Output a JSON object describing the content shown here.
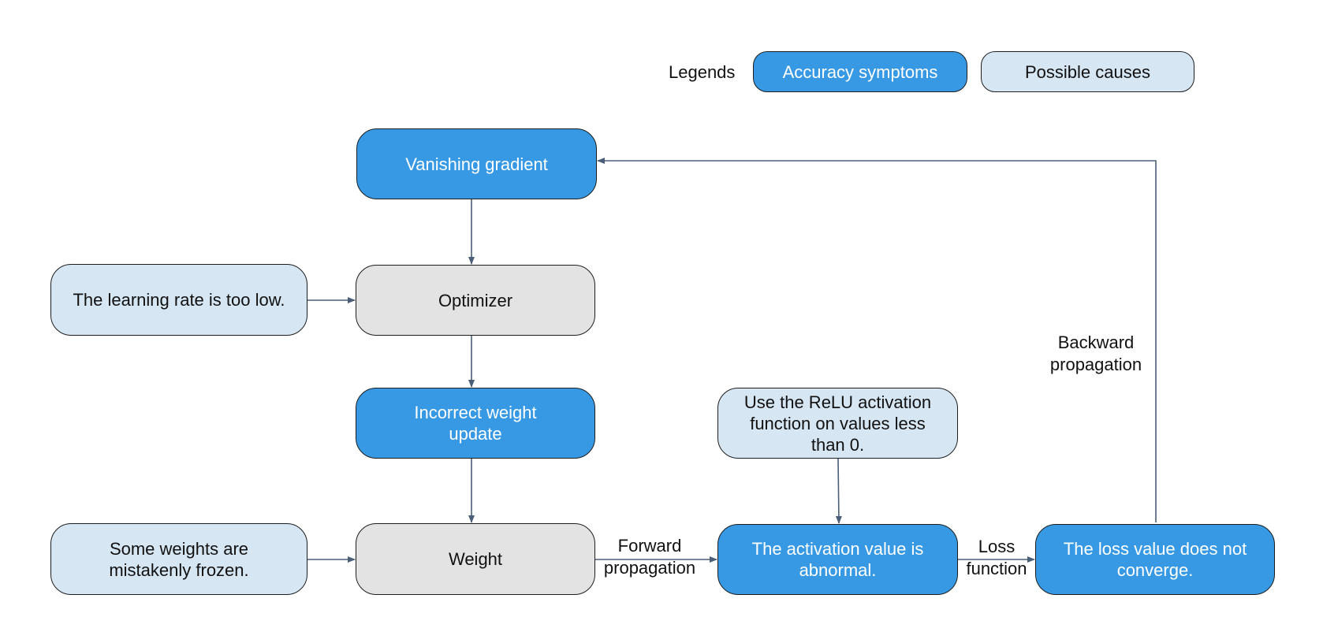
{
  "legend": {
    "title": "Legends",
    "items": [
      {
        "key": "symptom",
        "label": "Accuracy symptoms",
        "color": "#3799e3"
      },
      {
        "key": "cause",
        "label": "Possible causes",
        "color": "#d6e6f3"
      }
    ]
  },
  "colors": {
    "symptom": "#3799e3",
    "cause": "#d6e6f3",
    "process": "#e3e3e3",
    "connector": "#4a5e78",
    "border": "#1e1e1e"
  },
  "nodes": {
    "vanishing_gradient": {
      "label": "Vanishing gradient",
      "type": "symptom"
    },
    "learning_rate": {
      "label": "The learning rate is too low.",
      "type": "cause"
    },
    "optimizer": {
      "label": "Optimizer",
      "type": "process"
    },
    "incorrect_weight_update": {
      "label": "Incorrect weight\nupdate",
      "type": "symptom"
    },
    "frozen_weights": {
      "label": "Some weights are\nmistakenly frozen.",
      "type": "cause"
    },
    "weight": {
      "label": "Weight",
      "type": "process"
    },
    "relu": {
      "label": "Use the ReLU activation\nfunction on values less\nthan 0.",
      "type": "cause"
    },
    "activation_abnormal": {
      "label": "The activation value is\nabnormal.",
      "type": "symptom"
    },
    "loss_not_converge": {
      "label": "The loss value does not\nconverge.",
      "type": "symptom"
    }
  },
  "edges": [
    {
      "from": "vanishing_gradient",
      "to": "optimizer",
      "label": ""
    },
    {
      "from": "learning_rate",
      "to": "optimizer",
      "label": ""
    },
    {
      "from": "optimizer",
      "to": "incorrect_weight_update",
      "label": ""
    },
    {
      "from": "incorrect_weight_update",
      "to": "weight",
      "label": ""
    },
    {
      "from": "frozen_weights",
      "to": "weight",
      "label": ""
    },
    {
      "from": "weight",
      "to": "activation_abnormal",
      "label": "Forward\npropagation"
    },
    {
      "from": "relu",
      "to": "activation_abnormal",
      "label": ""
    },
    {
      "from": "activation_abnormal",
      "to": "loss_not_converge",
      "label": "Loss\nfunction"
    },
    {
      "from": "loss_not_converge",
      "to": "vanishing_gradient",
      "label": "Backward\npropagation"
    }
  ]
}
